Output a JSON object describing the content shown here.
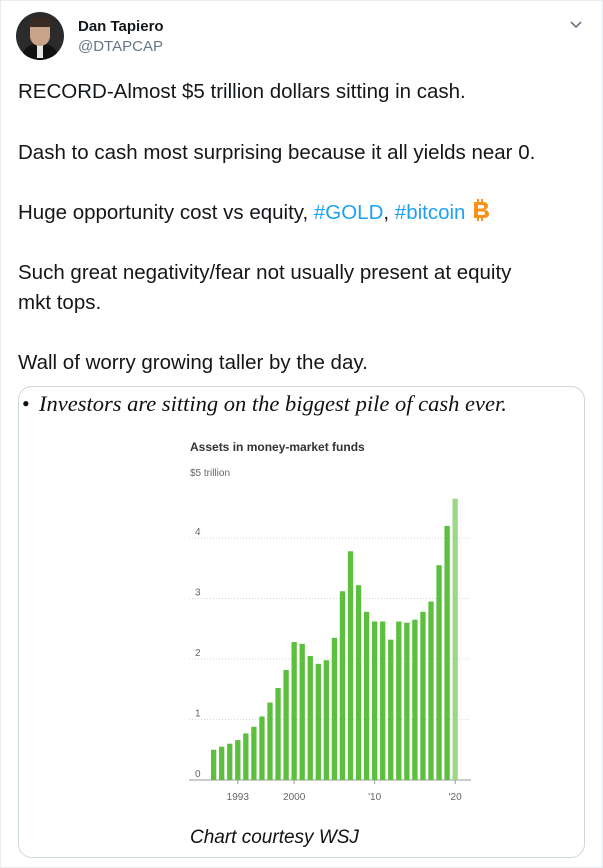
{
  "tweet": {
    "author_name": "Dan Tapiero",
    "author_handle": "@DTAPCAP",
    "line1": "RECORD-Almost $5 trillion dollars sitting in cash.",
    "line2": "Dash to cash most surprising because it all yields near 0.",
    "line3_prefix": "Huge opportunity cost vs equity, ",
    "hashtag_gold": "#GOLD",
    "separator": ",",
    "hashtag_bitcoin": "#bitcoin",
    "line4a": "Such great negativity/fear not usually present at equity",
    "line4b": "mkt tops.",
    "line5": "Wall of worry growing taller by the day.",
    "icons": {
      "menu": "chevron-down-icon",
      "emoji": "bitcoin-icon"
    },
    "colors": {
      "link": "#1da1f2",
      "bar": "#5cbf3d",
      "bar_latest": "#9bd989"
    }
  },
  "media": {
    "bullet": "•",
    "headline": "Investors are sitting on the biggest pile of cash ever.",
    "caption": "Chart courtesy WSJ"
  },
  "chart_data": {
    "type": "bar",
    "title": "Assets in money-market funds",
    "unit_label": "$5 trillion",
    "y_ticks": [
      "4",
      "3",
      "2",
      "1",
      "0"
    ],
    "x_ticks": [
      {
        "label": "1993",
        "year": 1993
      },
      {
        "label": "2000",
        "year": 2000
      },
      {
        "label": "'10",
        "year": 2010
      },
      {
        "label": "'20",
        "year": 2020
      }
    ],
    "ylim": [
      0,
      5
    ],
    "grid": true,
    "x": [
      1990,
      1991,
      1992,
      1993,
      1994,
      1995,
      1996,
      1997,
      1998,
      1999,
      2000,
      2001,
      2002,
      2003,
      2004,
      2005,
      2006,
      2007,
      2008,
      2009,
      2010,
      2011,
      2012,
      2013,
      2014,
      2015,
      2016,
      2017,
      2018,
      2019,
      2020
    ],
    "values": [
      0.5,
      0.55,
      0.6,
      0.66,
      0.77,
      0.88,
      1.05,
      1.28,
      1.52,
      1.82,
      2.28,
      2.25,
      2.05,
      1.92,
      1.98,
      2.35,
      3.12,
      3.78,
      3.22,
      2.78,
      2.62,
      2.62,
      2.32,
      2.62,
      2.6,
      2.65,
      2.78,
      2.95,
      3.55,
      4.2,
      4.65
    ]
  }
}
